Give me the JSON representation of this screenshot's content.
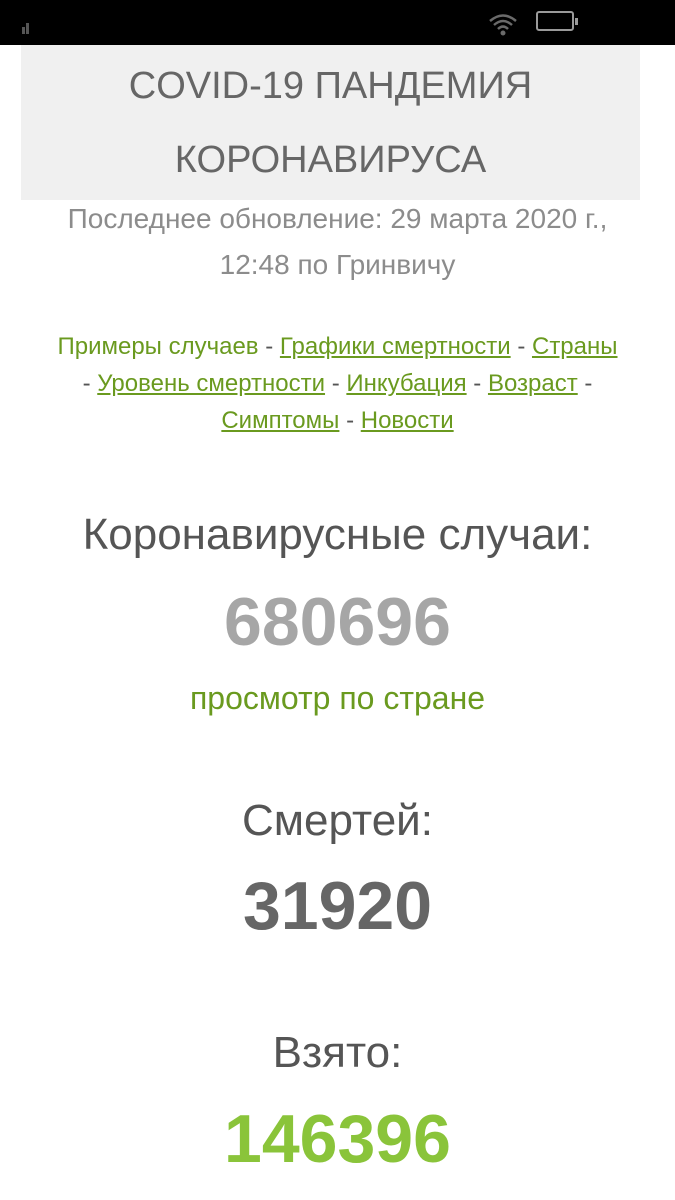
{
  "header": {
    "title_line1": "COVID-19 ПАНДЕМИЯ",
    "title_line2": "КОРОНАВИРУСА"
  },
  "updated": {
    "line1": "Последнее обновление: 29 марта 2020 г.,",
    "line2": "12:48 по Гринвичу"
  },
  "nav": {
    "links": [
      "Примеры случаев",
      "Графики смертности",
      "Страны",
      "Уровень смертности",
      "Инкубация",
      "Возраст",
      "Симптомы",
      "Новости"
    ],
    "separator": "-"
  },
  "cases": {
    "label": "Коронавирусные случаи:",
    "value": "680696",
    "link": "просмотр по стране"
  },
  "deaths": {
    "label": "Смертей:",
    "value": "31920"
  },
  "recovered": {
    "label": "Взято:",
    "value": "146396"
  },
  "colors": {
    "link_green": "#6a9a1f",
    "cases_gray": "#a6a6a6",
    "deaths_dark": "#666666",
    "recovered_green": "#8ac43a"
  },
  "status_bar": {
    "icons": [
      "signal-icon",
      "wifi-icon",
      "battery-icon"
    ]
  }
}
